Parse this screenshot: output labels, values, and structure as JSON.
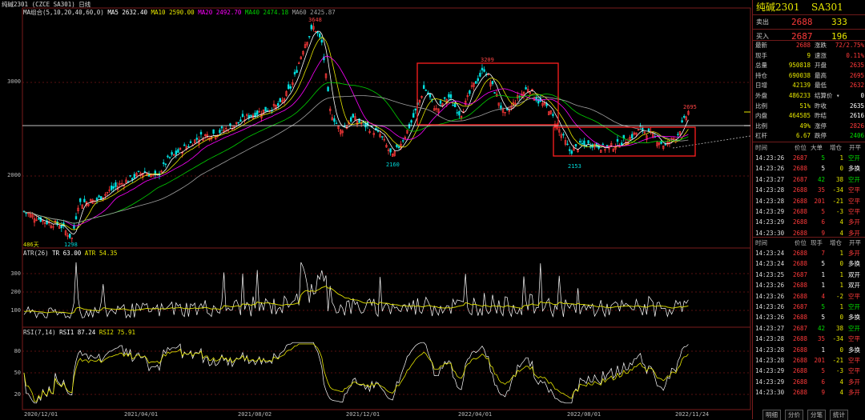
{
  "title": {
    "symbol_full": "纯碱2301",
    "code": "SA301",
    "top_left": "纯碱2301",
    "exchange_code": "(CZCE SA301)",
    "period": "日线"
  },
  "colors": {
    "up": "#ff3a3a",
    "down": "#00e0e0",
    "ma5": "#ffffff",
    "ma10": "#e6e600",
    "ma20": "#ff00ff",
    "ma40": "#00d000",
    "ma60": "#a0a0a0",
    "box": "#ff2020",
    "flat": "#ffffff",
    "green": "#00e000",
    "yellow": "#e6e600"
  },
  "main_panel": {
    "indicator_label": "MA组合(5,10,20,40,60,0)",
    "ma5": "MA5 2632.40",
    "ma10": "MA10 2590.00",
    "ma20": "MA20 2492.70",
    "ma40": "MA40 2474.18",
    "ma60": "MA60 2425.87",
    "y_ticks": [
      "3000",
      "2000"
    ],
    "price_labels": {
      "high": "3648",
      "mid_high": "3209",
      "last": "2695",
      "low1": "2160",
      "low2": "2153",
      "bottom": "1298",
      "days": "486天"
    }
  },
  "atr_panel": {
    "label": "ATR(26)",
    "tr": "TR 63.00",
    "atr": "ATR 54.35",
    "y_ticks": [
      "300",
      "200",
      "100"
    ]
  },
  "rsi_panel": {
    "label": "RSI(7,14)",
    "rsi1": "RSI1 87.24",
    "rsi2": "RSI2 75.91",
    "y_ticks": [
      "80",
      "50",
      "20"
    ]
  },
  "x_axis": [
    "2020/12/01",
    "2021/04/01",
    "2021/08/02",
    "2021/12/01",
    "2022/04/01",
    "2022/08/01",
    "2022/11/24"
  ],
  "quote": {
    "name": "纯碱2301",
    "code": "SA301",
    "sell_label": "卖出",
    "sell_price": "2688",
    "sell_vol": "333",
    "buy_label": "买入",
    "buy_price": "2687",
    "buy_vol": "196",
    "stats": [
      {
        "l1": "最新",
        "v1": "2688",
        "c1": "#ff3a3a",
        "l2": "涨跌",
        "v2": "72/2.75%",
        "c2": "#ff3a3a"
      },
      {
        "l1": "现手",
        "v1": "9",
        "c1": "#e6e600",
        "l2": "速涨",
        "v2": "0.11%",
        "c2": "#ff3a3a"
      },
      {
        "l1": "总量",
        "v1": "950818",
        "c1": "#e6e600",
        "l2": "开盘",
        "v2": "2635",
        "c2": "#ff3a3a"
      },
      {
        "l1": "持仓",
        "v1": "690038",
        "c1": "#e6e600",
        "l2": "最高",
        "v2": "2695",
        "c2": "#ff3a3a"
      },
      {
        "l1": "日增",
        "v1": "42139",
        "c1": "#e6e600",
        "l2": "最低",
        "v2": "2632",
        "c2": "#ff3a3a"
      },
      {
        "l1": "外盘",
        "v1": "486233",
        "c1": "#e6e600",
        "l2": "结算价 ▾",
        "v2": "0",
        "c2": "#ffffff"
      },
      {
        "l1": "比例",
        "v1": "51%",
        "c1": "#e6e600",
        "l2": "昨收",
        "v2": "2635",
        "c2": "#ffffff"
      },
      {
        "l1": "内盘",
        "v1": "464585",
        "c1": "#e6e600",
        "l2": "昨结",
        "v2": "2616",
        "c2": "#ffffff"
      },
      {
        "l1": "比例",
        "v1": "49%",
        "c1": "#e6e600",
        "l2": "涨停",
        "v2": "2826",
        "c2": "#ff3a3a"
      },
      {
        "l1": "杠杆",
        "v1": "6.67",
        "c1": "#e6e600",
        "l2": "跌停",
        "v2": "2406",
        "c2": "#00e000"
      }
    ]
  },
  "trades_header": [
    "时间",
    "价位",
    "大单",
    "增仓",
    "开平"
  ],
  "trades1": [
    {
      "t": "14:23:26",
      "p": "2687",
      "v": "5",
      "d": "1",
      "k": "空开",
      "dc": "#00e000"
    },
    {
      "t": "14:23:26",
      "p": "2688",
      "v": "5",
      "d": "0",
      "k": "多换",
      "dc": "#ffffff"
    },
    {
      "t": "14:23:27",
      "p": "2687",
      "v": "42",
      "d": "38",
      "k": "空开",
      "dc": "#00e000"
    },
    {
      "t": "14:23:28",
      "p": "2688",
      "v": "35",
      "d": "-34",
      "k": "空平",
      "dc": "#ff3a3a"
    },
    {
      "t": "14:23:28",
      "p": "2688",
      "v": "201",
      "d": "-21",
      "k": "空平",
      "dc": "#ff3a3a"
    },
    {
      "t": "14:23:29",
      "p": "2688",
      "v": "5",
      "d": "-3",
      "k": "空平",
      "dc": "#ff3a3a"
    },
    {
      "t": "14:23:29",
      "p": "2688",
      "v": "6",
      "d": "4",
      "k": "多开",
      "dc": "#ff3a3a"
    },
    {
      "t": "14:23:30",
      "p": "2688",
      "v": "9",
      "d": "4",
      "k": "多开",
      "dc": "#ff3a3a"
    }
  ],
  "trades2_header": [
    "时间",
    "价位",
    "现手",
    "增仓",
    "开平"
  ],
  "trades2": [
    {
      "t": "14:23:24",
      "p": "2688",
      "v": "7",
      "d": "1",
      "k": "多开",
      "dc": "#ff3a3a"
    },
    {
      "t": "14:23:24",
      "p": "2688",
      "v": "5",
      "d": "0",
      "k": "多换",
      "dc": "#ffffff"
    },
    {
      "t": "14:23:25",
      "p": "2687",
      "v": "1",
      "d": "1",
      "k": "双开",
      "dc": "#ffffff"
    },
    {
      "t": "14:23:26",
      "p": "2688",
      "v": "1",
      "d": "1",
      "k": "双开",
      "dc": "#ffffff"
    },
    {
      "t": "14:23:26",
      "p": "2688",
      "v": "4",
      "d": "-2",
      "k": "空平",
      "dc": "#ff3a3a"
    },
    {
      "t": "14:23:26",
      "p": "2687",
      "v": "5",
      "d": "1",
      "k": "空开",
      "dc": "#00e000"
    },
    {
      "t": "14:23:26",
      "p": "2688",
      "v": "5",
      "d": "0",
      "k": "多换",
      "dc": "#ffffff"
    },
    {
      "t": "14:23:27",
      "p": "2687",
      "v": "42",
      "d": "38",
      "k": "空开",
      "dc": "#00e000"
    },
    {
      "t": "14:23:28",
      "p": "2688",
      "v": "35",
      "d": "-34",
      "k": "空平",
      "dc": "#ff3a3a"
    },
    {
      "t": "14:23:28",
      "p": "2688",
      "v": "1",
      "d": "0",
      "k": "多换",
      "dc": "#ffffff"
    },
    {
      "t": "14:23:28",
      "p": "2688",
      "v": "201",
      "d": "-21",
      "k": "空平",
      "dc": "#ff3a3a"
    },
    {
      "t": "14:23:29",
      "p": "2688",
      "v": "5",
      "d": "-3",
      "k": "空平",
      "dc": "#ff3a3a"
    },
    {
      "t": "14:23:29",
      "p": "2688",
      "v": "6",
      "d": "4",
      "k": "多开",
      "dc": "#ff3a3a"
    },
    {
      "t": "14:23:30",
      "p": "2688",
      "v": "9",
      "d": "4",
      "k": "多开",
      "dc": "#ff3a3a"
    }
  ],
  "bottom_tabs": [
    "明细",
    "分价",
    "分笔",
    "统计"
  ]
}
